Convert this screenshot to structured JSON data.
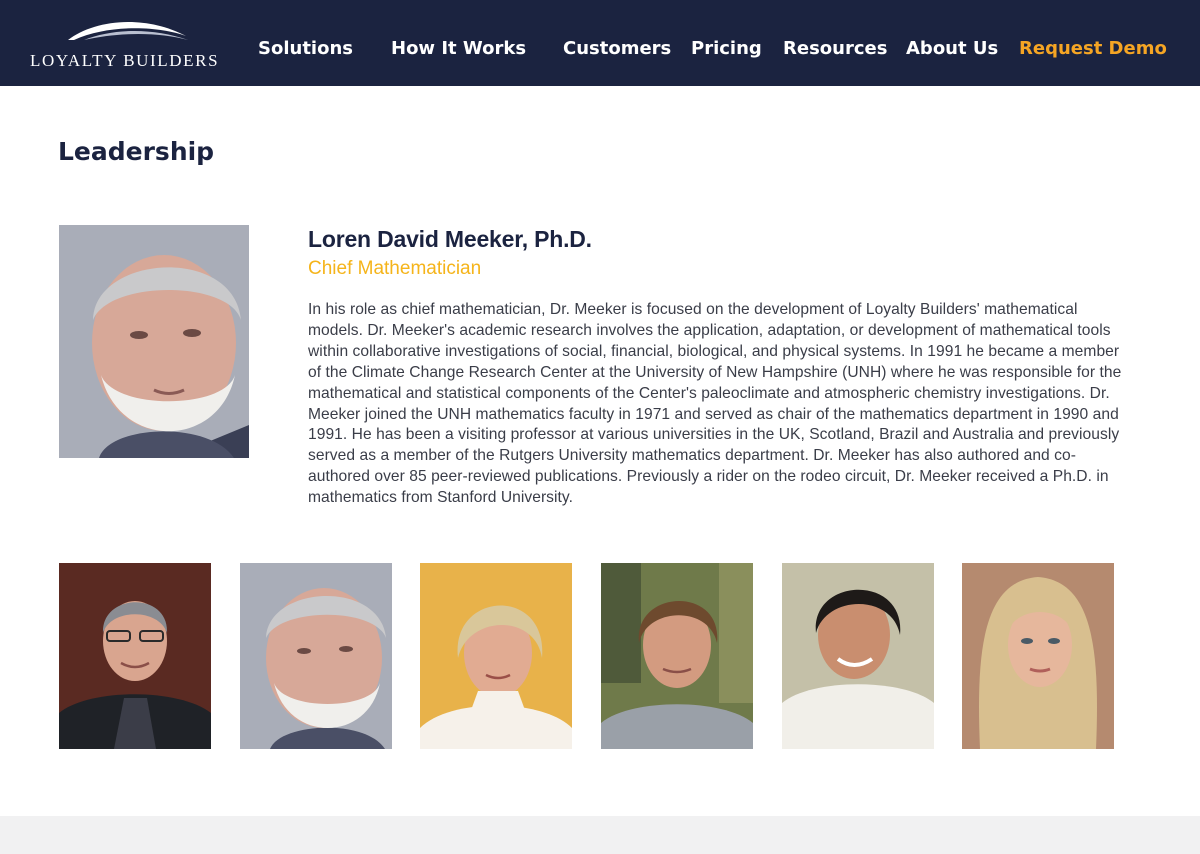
{
  "header": {
    "logo_text": "LOYALTY BUILDERS",
    "nav": [
      {
        "label": "Solutions"
      },
      {
        "label": "How It Works"
      },
      {
        "label": "Customers"
      },
      {
        "label": "Pricing"
      },
      {
        "label": "Resources"
      },
      {
        "label": "About Us"
      },
      {
        "label": "Request Demo"
      }
    ]
  },
  "main": {
    "title": "Leadership",
    "featured": {
      "name": "Loren David Meeker, Ph.D.",
      "role": "Chief Mathematician",
      "bio": "In his role as chief mathematician, Dr. Meeker is focused on the development of Loyalty Builders' mathematical models. Dr. Meeker's academic research involves the application, adaptation, or development of mathematical tools within collaborative investigations of social, financial, biological, and physical systems. In 1991 he became a member of the Climate Change Research Center at the University of New Hampshire (UNH) where he was responsible for the mathematical and statistical components of the Center's paleoclimate and atmospheric chemistry investigations. Dr. Meeker joined the UNH mathematics faculty in 1971 and served as chair of the mathematics department in 1990 and 1991. He has been a visiting professor at various universities in the UK, Scotland, Brazil and Australia and previously served as a member of the Rutgers University mathematics department. Dr. Meeker has also authored and co-authored over 85 peer-reviewed publications. Previously a rider on the rodeo circuit, Dr. Meeker received a Ph.D. in mathematics from Stanford University."
    },
    "team": [
      {
        "photo": "man-glasses-dark-suit"
      },
      {
        "photo": "older-man-white-beard"
      },
      {
        "photo": "woman-blonde-white-turtleneck"
      },
      {
        "photo": "man-brown-hair-grey-shirt"
      },
      {
        "photo": "man-dark-hair-smiling"
      },
      {
        "photo": "woman-long-blonde-hair"
      }
    ]
  },
  "colors": {
    "header_bg": "#1b2340",
    "accent": "#f5a524",
    "role": "#f5b41a",
    "title": "#1b2340"
  }
}
